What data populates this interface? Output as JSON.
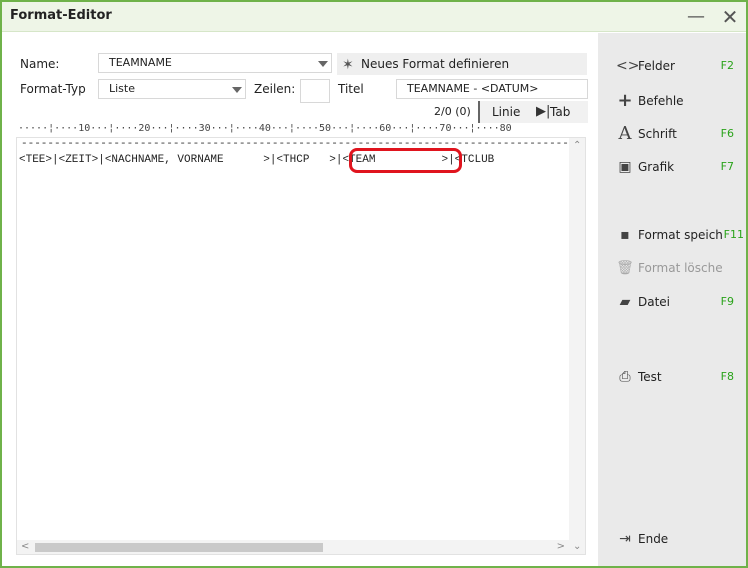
{
  "window": {
    "title": "Format-Editor",
    "minimize_glyph": "—",
    "close_glyph": "✕"
  },
  "form": {
    "name_label": "Name:",
    "name_value": "TEAMNAME",
    "new_format_label": "Neues Format definieren",
    "type_label": "Format-Typ",
    "type_value": "Liste",
    "rows_label": "Zeilen:",
    "rows_value": "",
    "title_label": "Titel",
    "title_value": "TEAMNAME - <DATUM>"
  },
  "toolbar": {
    "counter": "2/0 (0)",
    "line_label": "Linie",
    "tab_label": "Tab"
  },
  "ruler": "·····¦····10···¦····20···¦····30···¦····40···¦····50···¦····60···¦····70···¦····80",
  "editor": {
    "dashes": "--------------------------------------------------------------------------------------------------------------",
    "line1": "<TEE>|<ZEIT>|<NACHNAME, VORNAME      >|<THCP   >|<TEAM          >|<TCLUB",
    "highlight_note_color": "#e0141e"
  },
  "sidebar": {
    "items": [
      {
        "label": "Felder",
        "key": "F2",
        "icon": "code-brackets-icon"
      },
      {
        "label": "Befehle",
        "key": "",
        "icon": "plus-icon"
      },
      {
        "label": "Schrift",
        "key": "F6",
        "icon": "font-icon"
      },
      {
        "label": "Grafik",
        "key": "F7",
        "icon": "image-icon"
      },
      {
        "label": "Format speich",
        "key": "F11",
        "icon": "save-icon"
      },
      {
        "label": "Format lösche",
        "key": "",
        "icon": "trash-icon"
      },
      {
        "label": "Datei",
        "key": "F9",
        "icon": "folder-search-icon"
      },
      {
        "label": "Test",
        "key": "F8",
        "icon": "printer-icon"
      },
      {
        "label": "Ende",
        "key": "",
        "icon": "exit-icon"
      }
    ],
    "key_color": "#2aa31a"
  }
}
